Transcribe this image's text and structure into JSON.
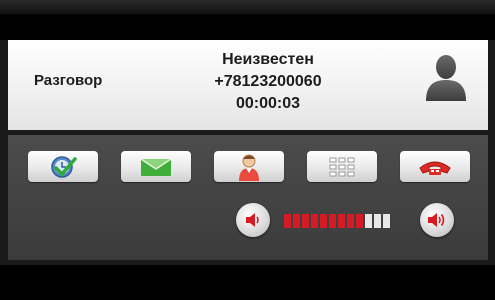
{
  "header": {
    "status": "Разговор",
    "caller_name": "Неизвестен",
    "caller_number": "+78123200060",
    "duration": "00:00:03"
  },
  "actions": [
    {
      "name": "history-button",
      "icon": "clock-check-icon"
    },
    {
      "name": "message-button",
      "icon": "envelope-icon"
    },
    {
      "name": "contact-button",
      "icon": "person-icon"
    },
    {
      "name": "keypad-button",
      "icon": "keypad-icon"
    },
    {
      "name": "hangup-button",
      "icon": "phone-hangup-icon"
    }
  ],
  "volume": {
    "level_fraction": 0.75,
    "segments_total": 12,
    "segments_on": 9,
    "active_color": "#d61b24",
    "inactive_color": "#e8e8e8"
  }
}
